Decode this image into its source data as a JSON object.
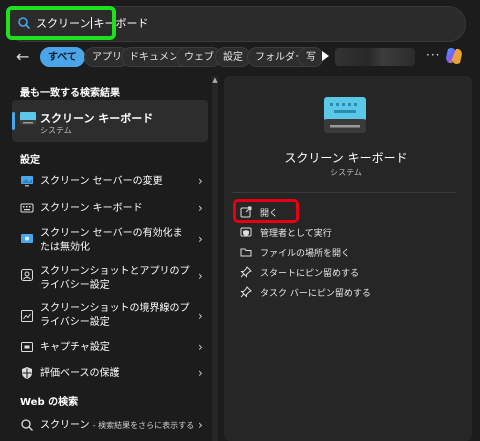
{
  "search": {
    "query_before_caret": "スクリーン",
    "query_after_caret": "キーボード"
  },
  "filters": [
    "すべて",
    "アプリ",
    "ドキュメント",
    "ウェブ",
    "設定",
    "フォルダー",
    "写"
  ],
  "more_label": "···",
  "left": {
    "best_match_title": "最も一致する検索結果",
    "best_match": {
      "title": "スクリーン キーボード",
      "subtitle": "システム"
    },
    "settings_title": "設定",
    "settings_items": [
      {
        "text": "スクリーン セーバーの変更",
        "icon": "screensaver-icon"
      },
      {
        "text": "スクリーン キーボード",
        "icon": "keyboard-icon"
      },
      {
        "text": "スクリーン セーバーの有効化または無効化",
        "icon": "screensaver-toggle-icon"
      },
      {
        "text": "スクリーンショットとアプリのプライバシー設定",
        "icon": "privacy-icon"
      },
      {
        "text": "スクリーンショットの境界線のプライバシー設定",
        "icon": "screenshot-border-icon"
      },
      {
        "text": "キャプチャ設定",
        "icon": "capture-icon"
      },
      {
        "text": "評価ベースの保護",
        "icon": "shield-icon"
      }
    ],
    "web_title": "Web の検索",
    "web_item": {
      "query": "スクリーン",
      "suffix": "- 検索結果をさらに表示する"
    }
  },
  "right": {
    "app_title": "スクリーン キーボード",
    "app_subtitle": "システム",
    "actions": [
      {
        "label": "開く",
        "icon": "open-icon"
      },
      {
        "label": "管理者として実行",
        "icon": "admin-icon"
      },
      {
        "label": "ファイルの場所を開く",
        "icon": "folder-icon"
      },
      {
        "label": "スタートにピン留めする",
        "icon": "pin-icon"
      },
      {
        "label": "タスク バーにピン留めする",
        "icon": "pin-taskbar-icon"
      }
    ]
  },
  "colors": {
    "accent": "#4aa6e8",
    "green_highlight": "#1fe01f",
    "red_highlight": "#e60012",
    "bg": "#1c1c1c",
    "panel": "#262626"
  }
}
